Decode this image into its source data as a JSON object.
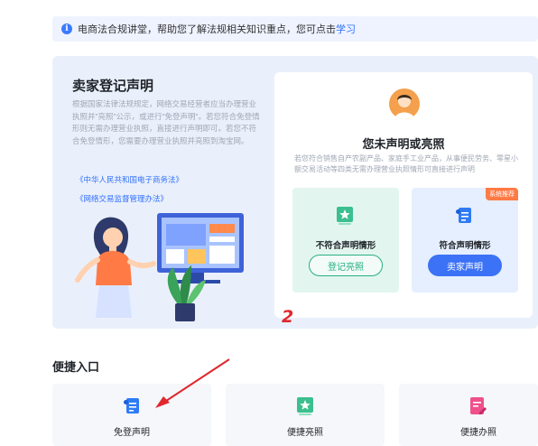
{
  "notice": {
    "text": "电商法合规讲堂，帮助您了解法规相关知识重点，您可点击",
    "link": "学习"
  },
  "left": {
    "title": "卖家登记声明",
    "description": "根据国家法律法规规定，网络交易经营者应当办理营业执照并\"亮照\"公示，或进行\"免登声明\"。若您符合免登情形则无需办理营业执照，直接进行声明即可。若您不符合免登情形，您需要办理营业执照并亮照到淘宝网。",
    "laws": [
      "《中华人民共和国电子商务法》",
      "《网络交易监督管理办法》"
    ]
  },
  "card": {
    "title": "您未声明或亮照",
    "description": "若您符合销售自产农副产品、家庭手工业产品，从事便民劳务、零星小额交易活动等四类无需办理营业执照情形可直接进行声明",
    "options": [
      {
        "label": "不符合声明情形",
        "button": "登记亮照"
      },
      {
        "label": "符合声明情形",
        "button": "卖家声明",
        "tag": "系统推荐"
      }
    ]
  },
  "annotation": "2",
  "quick_entry": {
    "title": "便捷入口",
    "items": [
      {
        "label": "免登声明",
        "icon": "declaration-scroll-icon"
      },
      {
        "label": "便捷亮照",
        "icon": "license-star-icon"
      },
      {
        "label": "便捷办照",
        "icon": "edit-document-icon"
      }
    ]
  },
  "colors": {
    "primary": "#3c72f6",
    "green": "#27b082",
    "panel": "#eaf0fb",
    "tag": "#ff7a45",
    "annotation_red": "#e0282e"
  }
}
